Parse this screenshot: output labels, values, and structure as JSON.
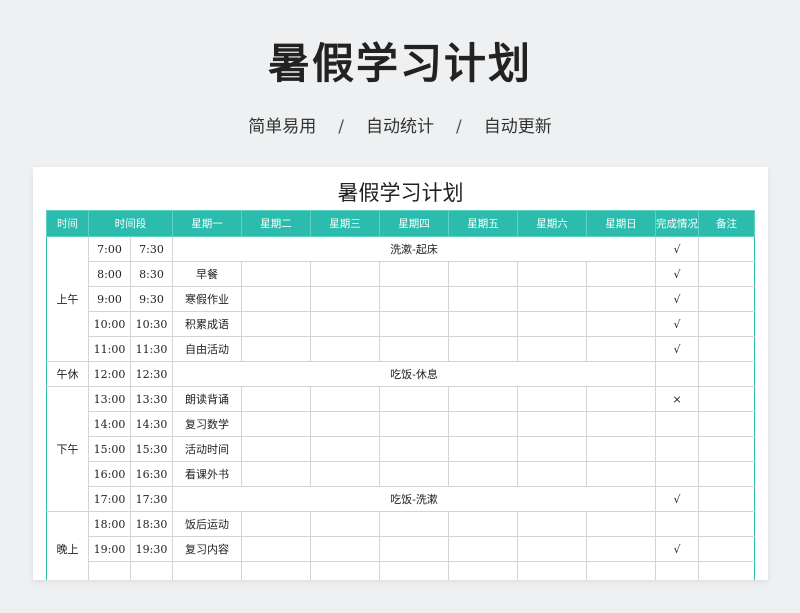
{
  "hero_title": "暑假学习计划",
  "subtitle": [
    "简单易用",
    "自动统计",
    "自动更新"
  ],
  "subtitle_sep": "/",
  "sheet_title": "暑假学习计划",
  "colors": {
    "header_bg": "#2bbcae",
    "header_text": "#ffffff"
  },
  "headers": [
    "时间",
    "时间段",
    "星期一",
    "星期二",
    "星期三",
    "星期四",
    "星期五",
    "星期六",
    "星期日",
    "完成情况",
    "备注"
  ],
  "rows": [
    {
      "period": "上午",
      "span": 5,
      "start": "7:00",
      "end": "7:30",
      "merged": "洗漱-起床",
      "done": "√"
    },
    {
      "start": "8:00",
      "end": "8:30",
      "mon": "早餐",
      "done": "√"
    },
    {
      "start": "9:00",
      "end": "9:30",
      "mon": "寒假作业",
      "done": "√"
    },
    {
      "start": "10:00",
      "end": "10:30",
      "mon": "积累成语",
      "done": "√"
    },
    {
      "start": "11:00",
      "end": "11:30",
      "mon": "自由活动",
      "done": "√"
    },
    {
      "period": "午休",
      "span": 1,
      "start": "12:00",
      "end": "12:30",
      "merged": "吃饭-休息",
      "done": ""
    },
    {
      "period": "下午",
      "span": 5,
      "start": "13:00",
      "end": "13:30",
      "mon": "朗读背诵",
      "done": "×"
    },
    {
      "start": "14:00",
      "end": "14:30",
      "mon": "复习数学",
      "done": ""
    },
    {
      "start": "15:00",
      "end": "15:30",
      "mon": "活动时间",
      "done": ""
    },
    {
      "start": "16:00",
      "end": "16:30",
      "mon": "看课外书",
      "done": ""
    },
    {
      "start": "17:00",
      "end": "17:30",
      "merged": "吃饭-洗漱",
      "done": "√"
    },
    {
      "period": "晚上",
      "span": 3,
      "start": "18:00",
      "end": "18:30",
      "mon": "饭后运动",
      "done": ""
    },
    {
      "start": "19:00",
      "end": "19:30",
      "mon": "复习内容",
      "done": "√"
    },
    {
      "start": "",
      "end": "",
      "mon": "",
      "done": ""
    }
  ]
}
